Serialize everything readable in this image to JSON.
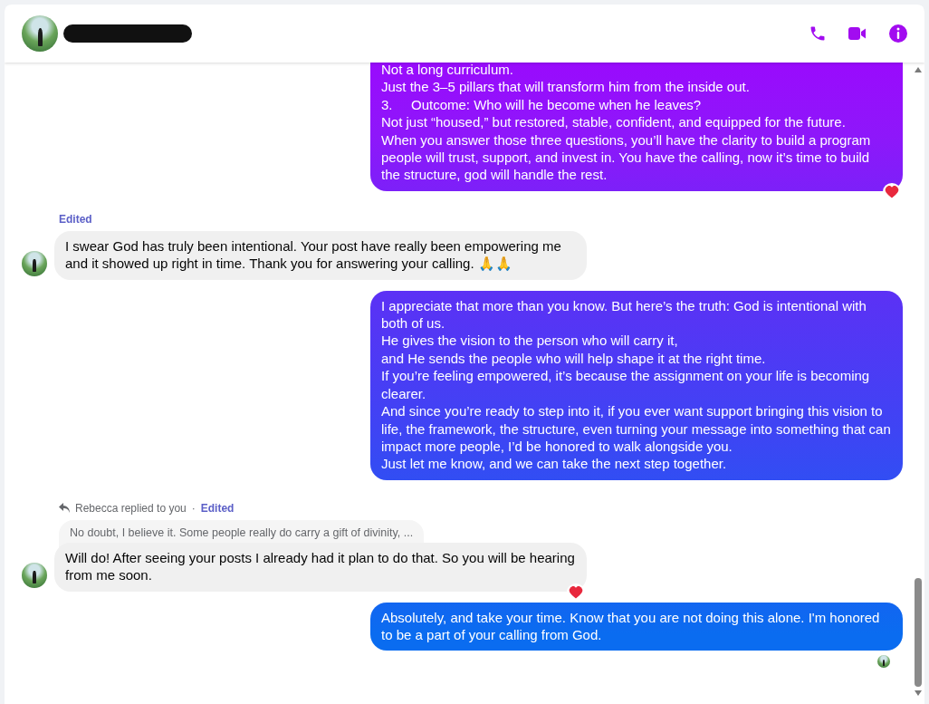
{
  "messages": [
    {
      "kind": "outgoing",
      "clipped_top": true,
      "lines": [
        {
          "text": "Not a long curriculum."
        },
        {
          "text": "Just the 3–5 pillars that will transform him from the inside out."
        },
        {
          "number": "3.",
          "text": "Outcome: Who will he become when he leaves?"
        },
        {
          "text": "Not just “housed,” but restored, stable, confident, and equipped for the future."
        },
        {
          "text": "When you answer those three questions, you’ll have the clarity to build a program people will trust, support, and invest in. You have the calling, now it’s time to build the structure, god will handle the rest."
        }
      ],
      "reacted": true
    },
    {
      "kind": "incoming",
      "edited": "Edited",
      "lines": [
        {
          "text": "I swear God has truly been intentional. Your post have really been empowering me and it showed up right in time. Thank you for answering your calling. 🙏🙏"
        }
      ],
      "reacted": false
    },
    {
      "kind": "outgoing",
      "lines": [
        {
          "text": "I appreciate that more than you know. But here’s the truth: God is intentional with both of us."
        },
        {
          "text": "He gives the vision to the person who will carry it,"
        },
        {
          "text": "and He sends the people who will help shape it at the right time."
        },
        {
          "text": "If you’re feeling empowered, it’s because the assignment on your life is becoming clearer."
        },
        {
          "text": "And since you’re ready to step into it, if you ever want support bringing this vision to life, the framework, the structure, even turning your message into something that can impact more people, I’d be honored to walk alongside you."
        },
        {
          "text": "Just let me know, and we can take the next step together."
        }
      ],
      "reacted": false
    },
    {
      "kind": "incoming",
      "reply_note": "Rebecca replied to you",
      "separator": "·",
      "edited": "Edited",
      "quote": "No doubt, I believe it. Some people really do carry a gift of divinity, ...",
      "lines": [
        {
          "text": "Will do!  After seeing your posts I already had it plan to do that. So you will be hearing from me soon."
        }
      ],
      "reacted": true
    },
    {
      "kind": "outgoing",
      "lines": [
        {
          "text": "Absolutely, and take your time. Know that you are not doing this alone. I'm honored to be a part of your calling from God."
        }
      ],
      "reacted": false,
      "seen": true
    }
  ]
}
